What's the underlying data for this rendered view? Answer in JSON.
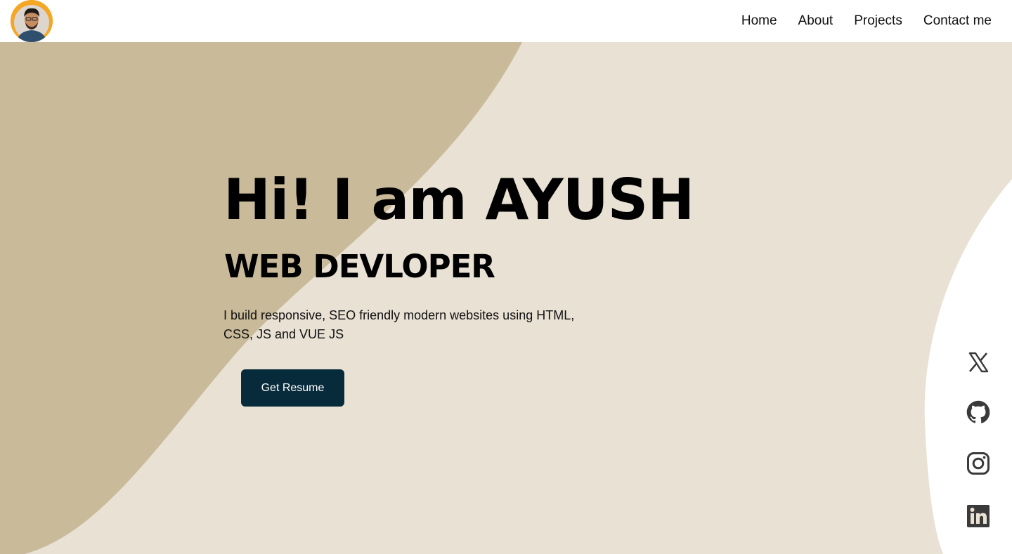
{
  "nav": {
    "links": [
      "Home",
      "About",
      "Projects",
      "Contact me"
    ]
  },
  "hero": {
    "title": "Hi! I am AYUSH",
    "subtitle": "WEB DEVLOPER",
    "description": "I build responsive, SEO friendly modern websites using HTML, CSS, JS and VUE JS",
    "button_label": "Get Resume"
  },
  "socials": [
    "x-icon",
    "github-icon",
    "instagram-icon",
    "linkedin-icon"
  ],
  "colors": {
    "background_light": "#e8e1d4",
    "background_dark": "#c9bb9a",
    "button": "#082b3b",
    "avatar_ring": "#f5a623",
    "icon": "#3a3a3a"
  }
}
